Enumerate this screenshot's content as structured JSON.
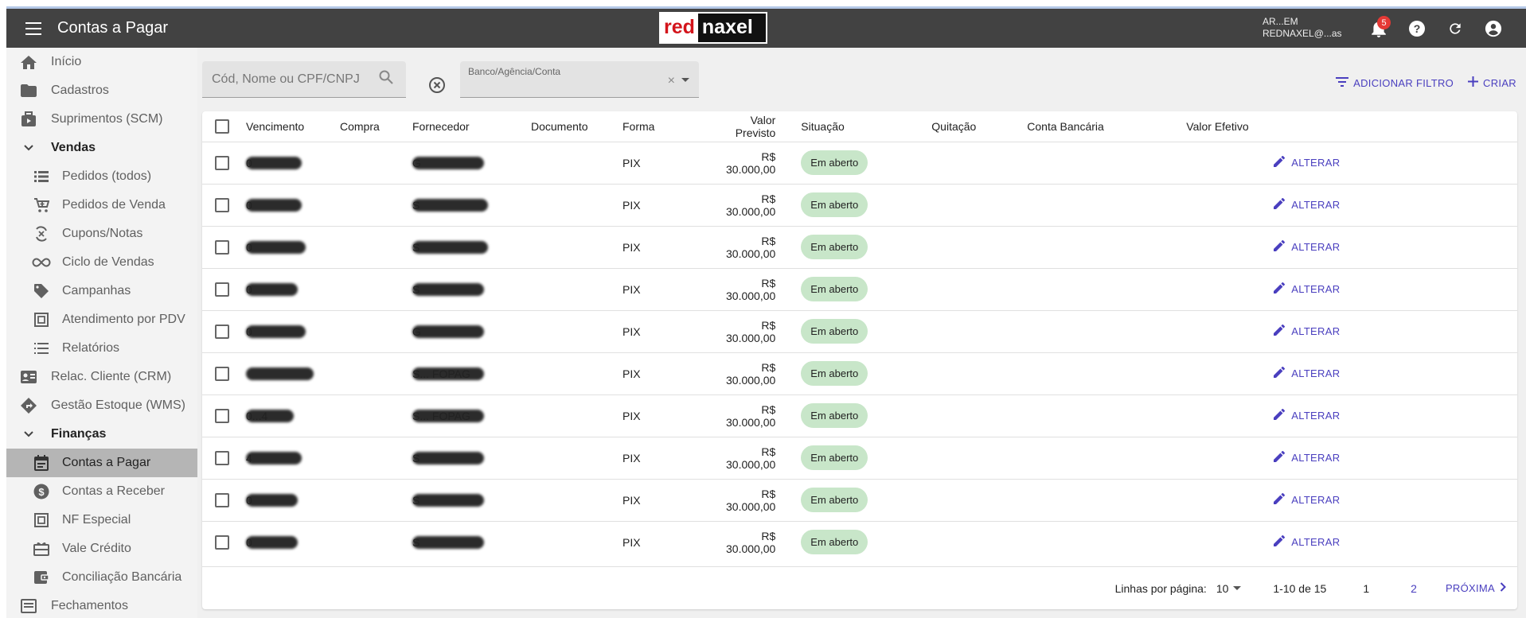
{
  "header": {
    "title": "Contas a Pagar",
    "logo_red": "red",
    "logo_rest": "naxel",
    "user_line1": "AR...EM",
    "user_line2": "REDNAXEL@...as",
    "notification_count": "5"
  },
  "sidebar": {
    "items": [
      {
        "label": "Início",
        "icon": "home-icon"
      },
      {
        "label": "Cadastros",
        "icon": "folder-icon"
      },
      {
        "label": "Suprimentos (SCM)",
        "icon": "supplies-icon"
      },
      {
        "label": "Vendas",
        "icon": "chevron-down-icon"
      },
      {
        "label": "Pedidos (todos)",
        "icon": "list-icon"
      },
      {
        "label": "Pedidos de Venda",
        "icon": "cart-icon"
      },
      {
        "label": "Cupons/Notas",
        "icon": "coupon-icon"
      },
      {
        "label": "Ciclo de Vendas",
        "icon": "infinity-icon"
      },
      {
        "label": "Campanhas",
        "icon": "tag-icon"
      },
      {
        "label": "Atendimento por PDV",
        "icon": "pdv-icon"
      },
      {
        "label": "Relatórios",
        "icon": "report-list-icon"
      },
      {
        "label": "Relac. Cliente (CRM)",
        "icon": "contact-card-icon"
      },
      {
        "label": "Gestão Estoque (WMS)",
        "icon": "directions-icon"
      },
      {
        "label": "Finanças",
        "icon": "chevron-down-icon"
      },
      {
        "label": "Contas a Pagar",
        "icon": "calendar-icon"
      },
      {
        "label": "Contas a Receber",
        "icon": "dollar-circle-icon"
      },
      {
        "label": "NF Especial",
        "icon": "document-box-icon"
      },
      {
        "label": "Vale Crédito",
        "icon": "gift-card-icon"
      },
      {
        "label": "Conciliação Bancária",
        "icon": "wallet-icon"
      },
      {
        "label": "Fechamentos",
        "icon": "list-alt-icon"
      }
    ]
  },
  "filters": {
    "search_placeholder": "Cód, Nome ou CPF/CNPJ",
    "bank_label": "Banco/Agência/Conta",
    "bank_clear": "×",
    "add_filter": "ADICIONAR FILTRO",
    "create": "CRIAR"
  },
  "table": {
    "columns": [
      "Vencimento",
      "Compra",
      "Fornecedor",
      "Documento",
      "Forma",
      "Valor Previsto",
      "Situação",
      "Quitação",
      "Conta Bancária",
      "Valor Efetivo"
    ],
    "rows": [
      {
        "vencimento": "0",
        "fornecedor": "G",
        "forma": "PIX",
        "valor": "R$ 30.000,00",
        "situacao": "Em aberto",
        "action": "ALTERAR"
      },
      {
        "vencimento": "0",
        "fornecedor": "S",
        "forma": "PIX",
        "valor": "R$ 30.000,00",
        "situacao": "Em aberto",
        "action": "ALTERAR"
      },
      {
        "vencimento": "0",
        "fornecedor": "S",
        "forma": "PIX",
        "valor": "R$ 30.000,00",
        "situacao": "Em aberto",
        "action": "ALTERAR"
      },
      {
        "vencimento": "0",
        "fornecedor": "S",
        "forma": "PIX",
        "valor": "R$ 30.000,00",
        "situacao": "Em aberto",
        "action": "ALTERAR"
      },
      {
        "vencimento": "0",
        "fornecedor": "G",
        "forma": "PIX",
        "valor": "R$ 30.000,00",
        "situacao": "Em aberto",
        "action": "ALTERAR"
      },
      {
        "vencimento": "",
        "fornecedor": "S... FOPAG",
        "forma": "PIX",
        "valor": "R$ 30.000,00",
        "situacao": "Em aberto",
        "action": "ALTERAR"
      },
      {
        "vencimento": "0...4",
        "fornecedor": "S... FOPAG",
        "forma": "PIX",
        "valor": "R$ 30.000,00",
        "situacao": "Em aberto",
        "action": "ALTERAR"
      },
      {
        "vencimento": "4",
        "fornecedor": "S",
        "forma": "PIX",
        "valor": "R$ 30.000,00",
        "situacao": "Em aberto",
        "action": "ALTERAR"
      },
      {
        "vencimento": "0",
        "fornecedor": "S",
        "forma": "PIX",
        "valor": "R$ 30.000,00",
        "situacao": "Em aberto",
        "action": "ALTERAR"
      },
      {
        "vencimento": "0",
        "fornecedor": "S",
        "forma": "PIX",
        "valor": "R$ 30.000,00",
        "situacao": "Em aberto",
        "action": "ALTERAR"
      }
    ]
  },
  "pagination": {
    "rows_per_page_label": "Linhas por página:",
    "rows_per_page": "10",
    "range": "1-10 de 15",
    "page1": "1",
    "page2": "2",
    "next": "PRÓXIMA"
  },
  "colors": {
    "topbar": "#424242",
    "accent": "#4a3fbf",
    "status_bg": "#c8e6c9",
    "active_nav": "#b5b5b5"
  }
}
